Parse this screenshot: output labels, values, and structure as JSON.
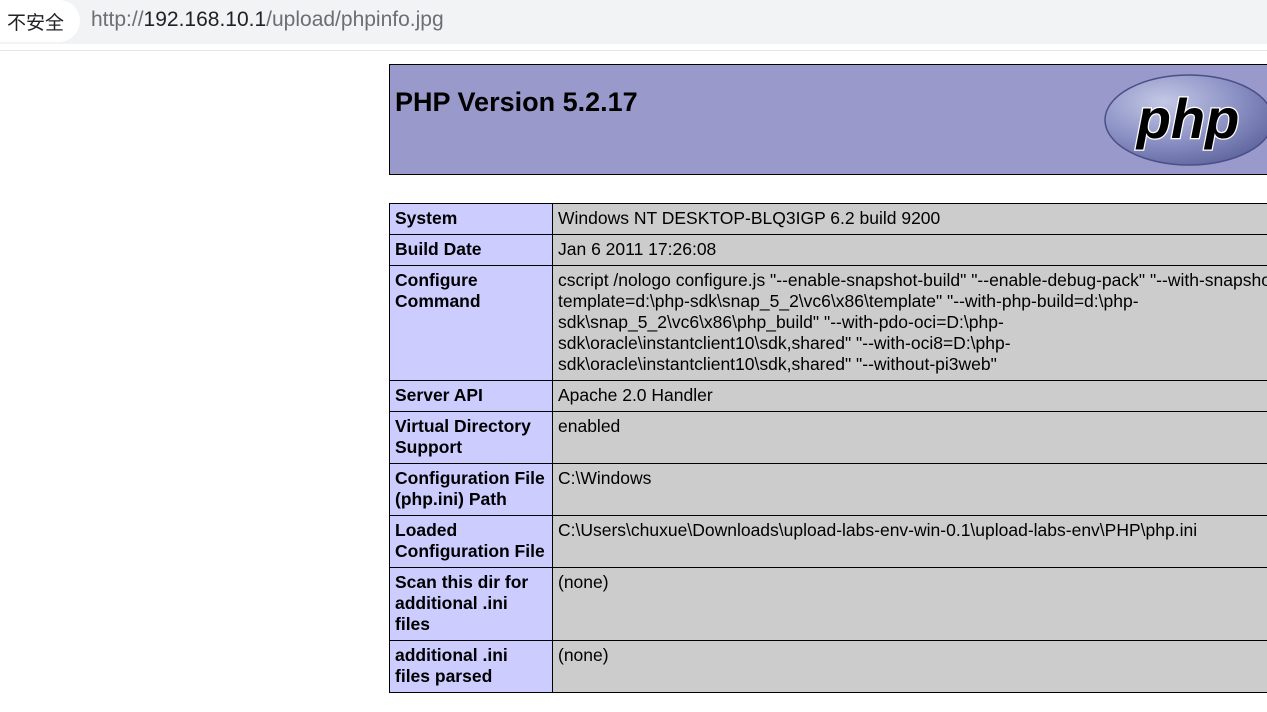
{
  "browser": {
    "security_label": "不安全",
    "url_prefix": "http://",
    "url_host": "192.168.10.1",
    "url_path": "/upload/phpinfo.jpg"
  },
  "page": {
    "title": "PHP Version 5.2.17",
    "logo_text": "php"
  },
  "info_table": [
    {
      "key": "System",
      "value": "Windows NT DESKTOP-BLQ3IGP 6.2 build 9200"
    },
    {
      "key": "Build Date",
      "value": "Jan 6 2011 17:26:08"
    },
    {
      "key": "Configure Command",
      "value": "cscript /nologo configure.js \"--enable-snapshot-build\" \"--enable-debug-pack\" \"--with-snapshot-template=d:\\php-sdk\\snap_5_2\\vc6\\x86\\template\" \"--with-php-build=d:\\php-sdk\\snap_5_2\\vc6\\x86\\php_build\" \"--with-pdo-oci=D:\\php-sdk\\oracle\\instantclient10\\sdk,shared\" \"--with-oci8=D:\\php-sdk\\oracle\\instantclient10\\sdk,shared\" \"--without-pi3web\""
    },
    {
      "key": "Server API",
      "value": "Apache 2.0 Handler"
    },
    {
      "key": "Virtual Directory Support",
      "value": "enabled"
    },
    {
      "key": "Configuration File (php.ini) Path",
      "value": "C:\\Windows"
    },
    {
      "key": "Loaded Configuration File",
      "value": "C:\\Users\\chuxue\\Downloads\\upload-labs-env-win-0.1\\upload-labs-env\\PHP\\php.ini"
    },
    {
      "key": "Scan this dir for additional .ini files",
      "value": "(none)"
    },
    {
      "key": "additional .ini files parsed",
      "value": "(none)"
    }
  ]
}
